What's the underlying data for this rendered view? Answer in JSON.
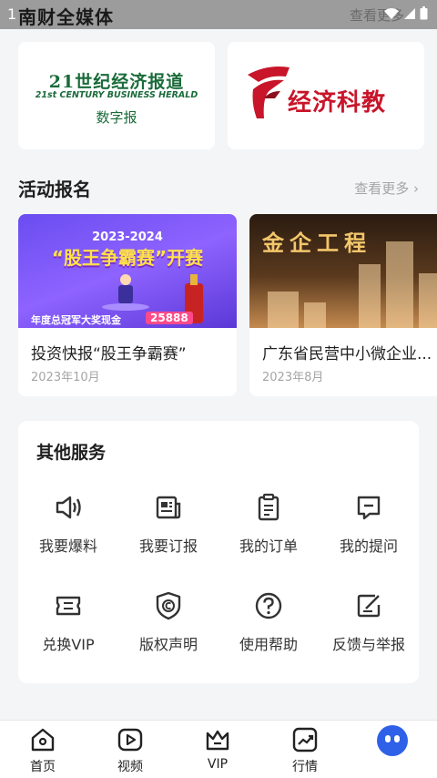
{
  "status_bar": {
    "time": "1",
    "title": "南财全媒体",
    "more": "查看更多"
  },
  "top_cards": {
    "paper": {
      "name": "21世纪经济报道",
      "english": "21st CENTURY BUSINESS HERALD",
      "subtitle": "数字报"
    },
    "edu": {
      "name": "经济科教"
    }
  },
  "activities": {
    "title": "活动报名",
    "see_more": "查看更多",
    "items": [
      {
        "title": "投资快报“股王争霸赛”",
        "date": "2023年10月",
        "banner_year": "2023-2024",
        "banner_head": "“股王争霸赛”开赛",
        "banner_prize": "年度总冠军大奖现金",
        "banner_amount": "25888"
      },
      {
        "title": "广东省民营中小微企业...",
        "date": "2023年8月",
        "banner_head": "金企工程"
      }
    ]
  },
  "services": {
    "title": "其他服务",
    "items": [
      {
        "label": "我要爆料",
        "icon": "speaker-icon"
      },
      {
        "label": "我要订报",
        "icon": "newspaper-icon"
      },
      {
        "label": "我的订单",
        "icon": "clipboard-icon"
      },
      {
        "label": "我的提问",
        "icon": "message-icon"
      },
      {
        "label": "兑换VIP",
        "icon": "ticket-icon"
      },
      {
        "label": "版权声明",
        "icon": "copyright-shield-icon"
      },
      {
        "label": "使用帮助",
        "icon": "help-icon"
      },
      {
        "label": "反馈与举报",
        "icon": "edit-icon"
      }
    ]
  },
  "bottom_nav": {
    "items": [
      {
        "label": "首页",
        "icon": "home-icon"
      },
      {
        "label": "视频",
        "icon": "play-icon"
      },
      {
        "label": "VIP",
        "icon": "crown-icon"
      },
      {
        "label": "行情",
        "icon": "chart-icon"
      }
    ]
  },
  "colors": {
    "brand_green": "#1a6b3a",
    "brand_red": "#c8152a",
    "accent_blue": "#2f61e8"
  }
}
